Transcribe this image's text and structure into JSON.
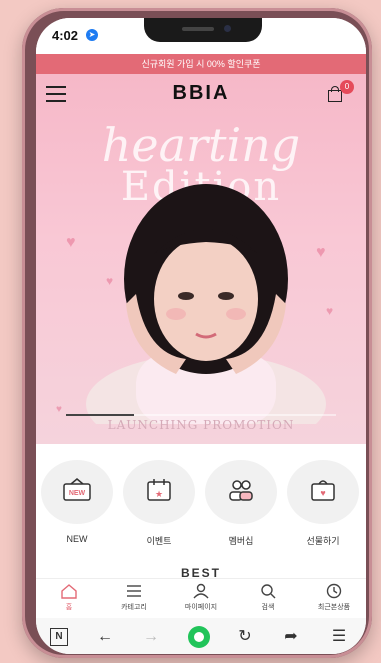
{
  "status_bar": {
    "time": "4:02"
  },
  "promo_banner": {
    "text": "신규회원 가입 시 00% 할인쿠폰"
  },
  "header": {
    "logo": "BBIA",
    "cart_count": "0"
  },
  "hero": {
    "title_line1": "hearting",
    "title_line2": "Edition",
    "caption": "LAUNCHING PROMOTION",
    "progress": 0.25
  },
  "quick_menu": [
    {
      "label": "NEW",
      "icon": "new-sign-icon"
    },
    {
      "label": "이벤트",
      "icon": "calendar-star-icon"
    },
    {
      "label": "멤버십",
      "icon": "members-icon"
    },
    {
      "label": "선물하기",
      "icon": "gift-bag-icon"
    }
  ],
  "section_heading": "BEST",
  "tab_bar": [
    {
      "label": "홈",
      "icon": "home-icon",
      "active": true
    },
    {
      "label": "카테고리",
      "icon": "menu-icon",
      "active": false
    },
    {
      "label": "마이페이지",
      "icon": "user-icon",
      "active": false
    },
    {
      "label": "검색",
      "icon": "search-icon",
      "active": false
    },
    {
      "label": "최근본상품",
      "icon": "clock-icon",
      "active": false
    }
  ],
  "colors": {
    "accent": "#e36a76",
    "hero_bg": "#f6b8c8",
    "browser_green": "#21c45a"
  }
}
